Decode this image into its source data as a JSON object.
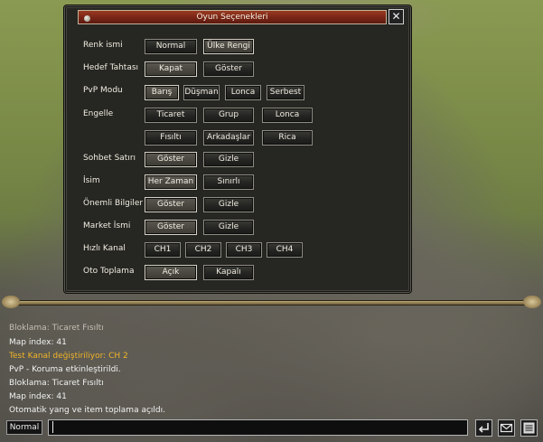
{
  "window": {
    "title": "Oyun Seçenekleri",
    "close_label": "✕"
  },
  "options": {
    "name_color": {
      "label": "Renk ismi",
      "buttons": [
        "Normal",
        "Ülke Rengi"
      ]
    },
    "target_board": {
      "label": "Hedef Tahtası",
      "buttons": [
        "Kapat",
        "Göster"
      ]
    },
    "pvp_mode": {
      "label": "PvP Modu",
      "buttons": [
        "Barış",
        "Düşman",
        "Lonca",
        "Serbest"
      ]
    },
    "block": {
      "label": "Engelle",
      "buttons": [
        "Ticaret",
        "Grup",
        "Lonca",
        "Fısıltı",
        "Arkadaşlar",
        "Rica"
      ]
    },
    "chat_line": {
      "label": "Sohbet Satırı",
      "buttons": [
        "Göster",
        "Gizle"
      ]
    },
    "name": {
      "label": "İsim",
      "buttons": [
        "Her Zaman",
        "Sınırlı"
      ]
    },
    "important_info": {
      "label": "Önemli Bilgiler",
      "buttons": [
        "Göster",
        "Gizle"
      ]
    },
    "market_name": {
      "label": "Market İsmi",
      "buttons": [
        "Göster",
        "Gizle"
      ]
    },
    "quick_channel": {
      "label": "Hızlı Kanal",
      "buttons": [
        "CH1",
        "CH2",
        "CH3",
        "CH4"
      ]
    },
    "auto_loot": {
      "label": "Oto Toplama",
      "buttons": [
        "Açık",
        "Kapalı"
      ]
    }
  },
  "chat": {
    "messages": [
      {
        "text": "Bloklama:  Ticaret Fısıltı",
        "color": "#c8beb4"
      },
      {
        "text": "Map index: 41",
        "color": "#f2f2f2"
      },
      {
        "text": "Test Kanal değiştiriliyor: CH 2",
        "color": "#f0b428"
      },
      {
        "text": "PvP - Koruma etkinleştirildi.",
        "color": "#f2f2f2"
      },
      {
        "text": "Bloklama:  Ticaret Fısıltı",
        "color": "#f2f2f2"
      },
      {
        "text": "Map index: 41",
        "color": "#f2f2f2"
      },
      {
        "text": "Otomatik yang ve item toplama açıldı.",
        "color": "#f2f2f2"
      }
    ],
    "mode": "Normal",
    "input_value": ""
  },
  "icons": [
    "send-icon",
    "mail-icon",
    "chat-log-icon"
  ]
}
